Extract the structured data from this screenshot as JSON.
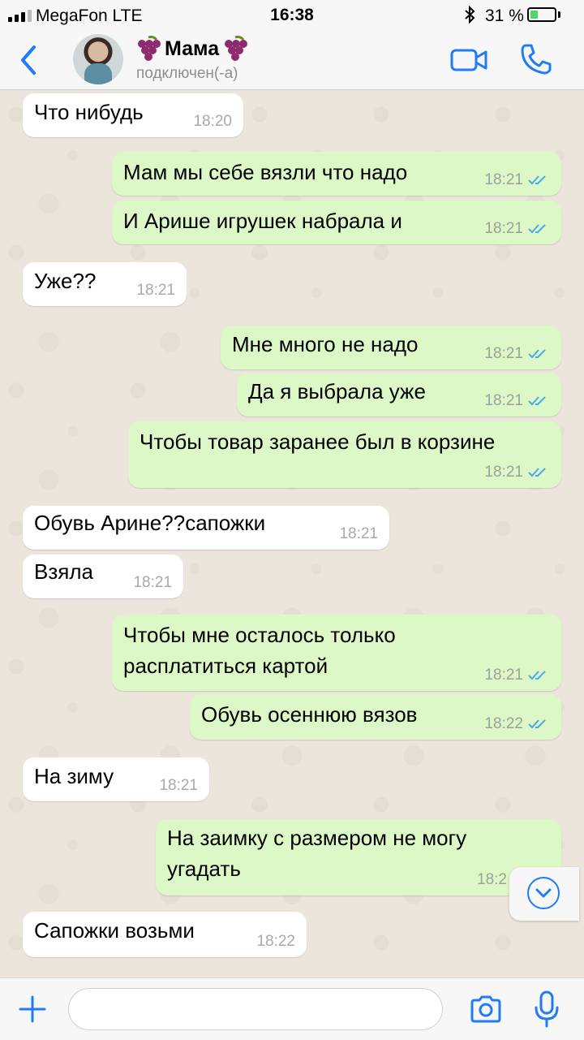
{
  "status_bar": {
    "carrier": "MegaFon  LTE",
    "time": "16:38",
    "bluetooth": "bluetooth-icon",
    "battery_percent": "31 %",
    "battery_level": 0.31
  },
  "header": {
    "contact_name": "Мама",
    "status": "подключен(-а)",
    "icons": [
      "back-icon",
      "grape-emoji",
      "video-call-icon",
      "phone-icon"
    ]
  },
  "messages": [
    {
      "dir": "in",
      "text": "Что нибудь",
      "time": "18:20"
    },
    {
      "dir": "out",
      "text": "Мам мы себе вязли что надо",
      "time": "18:21"
    },
    {
      "dir": "out",
      "text": "И Арише игрушек набрала и",
      "time": "18:21"
    },
    {
      "dir": "in",
      "text": "Уже??",
      "time": "18:21"
    },
    {
      "dir": "out",
      "text": "Мне много не надо",
      "time": "18:21"
    },
    {
      "dir": "out",
      "text": "Да я выбрала уже",
      "time": "18:21"
    },
    {
      "dir": "out",
      "text": "Чтобы товар заранее был в корзине",
      "time": "18:21"
    },
    {
      "dir": "in",
      "text": "Обувь Арине??сапожки",
      "time": "18:21"
    },
    {
      "dir": "in",
      "text": "Взяла",
      "time": "18:21"
    },
    {
      "dir": "out",
      "text": "Чтобы мне осталось только\nрасплатиться картой",
      "time": "18:21"
    },
    {
      "dir": "out",
      "text": "Обувь осеннюю вязов",
      "time": "18:22"
    },
    {
      "dir": "in",
      "text": "На зиму",
      "time": "18:21"
    },
    {
      "dir": "out",
      "text": "На заимку с размером не могу\nугадать",
      "time": "18:2"
    },
    {
      "dir": "in",
      "text": "Сапожки возьми",
      "time": "18:22"
    }
  ],
  "colors": {
    "outgoing_bubble": "#dcf8c6",
    "incoming_bubble": "#ffffff",
    "accent": "#1f7bf6",
    "read_ticks": "#4fa8e8"
  },
  "input_bar": {
    "placeholder": "",
    "icons": [
      "plus-icon",
      "camera-icon",
      "microphone-icon"
    ]
  }
}
